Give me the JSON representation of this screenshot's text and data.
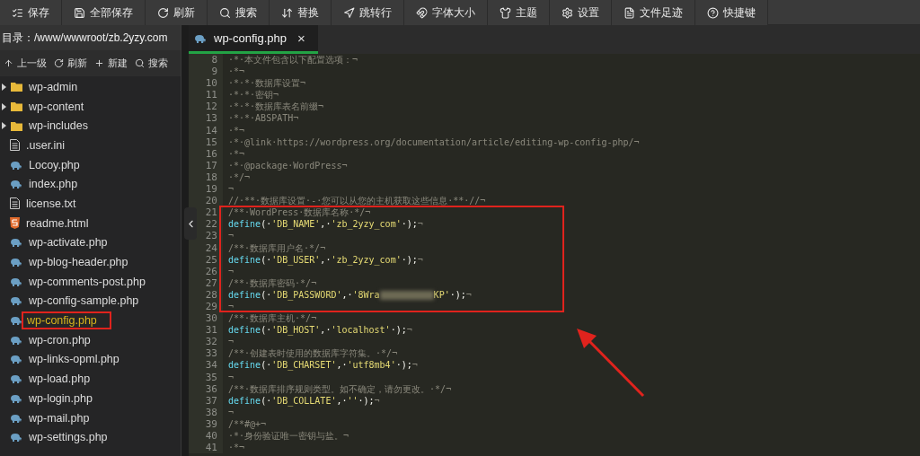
{
  "toolbar": [
    {
      "label": "保存"
    },
    {
      "label": "全部保存"
    },
    {
      "label": "刷新"
    },
    {
      "label": "搜索"
    },
    {
      "label": "替换"
    },
    {
      "label": "跳转行"
    },
    {
      "label": "字体大小"
    },
    {
      "label": "主题"
    },
    {
      "label": "设置"
    },
    {
      "label": "文件足迹"
    },
    {
      "label": "快捷键"
    }
  ],
  "sidebar": {
    "path": "目录：/www/wwwroot/zb.2yzy.com",
    "tools": [
      {
        "label": "上一级"
      },
      {
        "label": "刷新"
      },
      {
        "label": "新建"
      },
      {
        "label": "搜索"
      }
    ],
    "files": [
      {
        "name": "wp-admin",
        "kind": "folder",
        "selected": false
      },
      {
        "name": "wp-content",
        "kind": "folder",
        "selected": false
      },
      {
        "name": "wp-includes",
        "kind": "folder",
        "selected": false
      },
      {
        "name": ".user.ini",
        "kind": "text",
        "selected": false
      },
      {
        "name": "Locoy.php",
        "kind": "php",
        "selected": false
      },
      {
        "name": "index.php",
        "kind": "php",
        "selected": false
      },
      {
        "name": "license.txt",
        "kind": "text",
        "selected": false
      },
      {
        "name": "readme.html",
        "kind": "html",
        "selected": false
      },
      {
        "name": "wp-activate.php",
        "kind": "php",
        "selected": false
      },
      {
        "name": "wp-blog-header.php",
        "kind": "php",
        "selected": false
      },
      {
        "name": "wp-comments-post.php",
        "kind": "php",
        "selected": false
      },
      {
        "name": "wp-config-sample.php",
        "kind": "php",
        "selected": false
      },
      {
        "name": "wp-config.php",
        "kind": "php",
        "selected": true
      },
      {
        "name": "wp-cron.php",
        "kind": "php",
        "selected": false
      },
      {
        "name": "wp-links-opml.php",
        "kind": "php",
        "selected": false
      },
      {
        "name": "wp-load.php",
        "kind": "php",
        "selected": false
      },
      {
        "name": "wp-login.php",
        "kind": "php",
        "selected": false
      },
      {
        "name": "wp-mail.php",
        "kind": "php",
        "selected": false
      },
      {
        "name": "wp-settings.php",
        "kind": "php",
        "selected": false
      }
    ]
  },
  "tabs": [
    {
      "label": "wp-config.php",
      "close": "×",
      "selected": true
    }
  ],
  "editor": {
    "lines": [
      {
        "no": "8",
        "parts": [
          {
            "kind": "comment",
            "text": "·*·本文件包含以下配置选项：¬"
          }
        ]
      },
      {
        "no": "9",
        "parts": [
          {
            "kind": "comment",
            "text": "·*¬"
          }
        ]
      },
      {
        "no": "10",
        "parts": [
          {
            "kind": "comment",
            "text": "·*·*·数据库设置¬"
          }
        ]
      },
      {
        "no": "11",
        "parts": [
          {
            "kind": "comment",
            "text": "·*·*·密钥¬"
          }
        ]
      },
      {
        "no": "12",
        "parts": [
          {
            "kind": "comment",
            "text": "·*·*·数据库表名前缀¬"
          }
        ]
      },
      {
        "no": "13",
        "parts": [
          {
            "kind": "comment",
            "text": "·*·*·ABSPATH¬"
          }
        ]
      },
      {
        "no": "14",
        "parts": [
          {
            "kind": "comment",
            "text": "·*¬"
          }
        ]
      },
      {
        "no": "15",
        "parts": [
          {
            "kind": "comment",
            "text": "·*·@link·https://wordpress.org/documentation/article/editing-wp-config-php/¬"
          }
        ]
      },
      {
        "no": "16",
        "parts": [
          {
            "kind": "comment",
            "text": "·*¬"
          }
        ]
      },
      {
        "no": "17",
        "parts": [
          {
            "kind": "comment",
            "text": "·*·@package·WordPress¬"
          }
        ]
      },
      {
        "no": "18",
        "parts": [
          {
            "kind": "comment",
            "text": "·*/¬"
          }
        ]
      },
      {
        "no": "19",
        "parts": [
          {
            "kind": "comment",
            "text": "¬"
          }
        ]
      },
      {
        "no": "20",
        "parts": [
          {
            "kind": "comment",
            "text": "//·**·数据库设置·-·您可以从您的主机获取这些信息·**·//¬"
          }
        ]
      },
      {
        "no": "21",
        "parts": [
          {
            "kind": "comment",
            "text": "/**·WordPress·数据库名称·*/¬"
          }
        ]
      },
      {
        "no": "22",
        "parts": [
          {
            "kind": "fn",
            "text": "define"
          },
          {
            "kind": "punct",
            "text": "(·"
          },
          {
            "kind": "string",
            "text": "'DB_NAME'"
          },
          {
            "kind": "punct",
            "text": ",·"
          },
          {
            "kind": "string",
            "text": "'zb_2yzy_com'"
          },
          {
            "kind": "punct",
            "text": "·);"
          },
          {
            "kind": "comment",
            "text": "¬"
          }
        ]
      },
      {
        "no": "23",
        "parts": [
          {
            "kind": "comment",
            "text": "¬"
          }
        ]
      },
      {
        "no": "24",
        "parts": [
          {
            "kind": "comment",
            "text": "/**·数据库用户名·*/¬"
          }
        ]
      },
      {
        "no": "25",
        "parts": [
          {
            "kind": "fn",
            "text": "define"
          },
          {
            "kind": "punct",
            "text": "(·"
          },
          {
            "kind": "string",
            "text": "'DB_USER'"
          },
          {
            "kind": "punct",
            "text": ",·"
          },
          {
            "kind": "string",
            "text": "'zb_2yzy_com'"
          },
          {
            "kind": "punct",
            "text": "·);"
          },
          {
            "kind": "comment",
            "text": "¬"
          }
        ]
      },
      {
        "no": "26",
        "parts": [
          {
            "kind": "comment",
            "text": "¬"
          }
        ]
      },
      {
        "no": "27",
        "parts": [
          {
            "kind": "comment",
            "text": "/**·数据库密码·*/¬"
          }
        ]
      },
      {
        "no": "28",
        "parts": [
          {
            "kind": "fn",
            "text": "define"
          },
          {
            "kind": "punct",
            "text": "(·"
          },
          {
            "kind": "string",
            "text": "'DB_PASSWORD'"
          },
          {
            "kind": "punct",
            "text": ",·"
          },
          {
            "kind": "string",
            "text": "'8Wra"
          },
          {
            "kind": "redacted"
          },
          {
            "kind": "string",
            "text": "KP'"
          },
          {
            "kind": "punct",
            "text": "·);"
          },
          {
            "kind": "comment",
            "text": "¬"
          }
        ]
      },
      {
        "no": "29",
        "parts": [
          {
            "kind": "comment",
            "text": "¬"
          }
        ]
      },
      {
        "no": "30",
        "parts": [
          {
            "kind": "comment",
            "text": "/**·数据库主机·*/¬"
          }
        ]
      },
      {
        "no": "31",
        "parts": [
          {
            "kind": "fn",
            "text": "define"
          },
          {
            "kind": "punct",
            "text": "(·"
          },
          {
            "kind": "string",
            "text": "'DB_HOST'"
          },
          {
            "kind": "punct",
            "text": ",·"
          },
          {
            "kind": "string",
            "text": "'localhost'"
          },
          {
            "kind": "punct",
            "text": "·);"
          },
          {
            "kind": "comment",
            "text": "¬"
          }
        ]
      },
      {
        "no": "32",
        "parts": [
          {
            "kind": "comment",
            "text": "¬"
          }
        ]
      },
      {
        "no": "33",
        "parts": [
          {
            "kind": "comment",
            "text": "/**·创建表时使用的数据库字符集。·*/¬"
          }
        ]
      },
      {
        "no": "34",
        "parts": [
          {
            "kind": "fn",
            "text": "define"
          },
          {
            "kind": "punct",
            "text": "(·"
          },
          {
            "kind": "string",
            "text": "'DB_CHARSET'"
          },
          {
            "kind": "punct",
            "text": ",·"
          },
          {
            "kind": "string",
            "text": "'utf8mb4'"
          },
          {
            "kind": "punct",
            "text": "·);"
          },
          {
            "kind": "comment",
            "text": "¬"
          }
        ]
      },
      {
        "no": "35",
        "parts": [
          {
            "kind": "comment",
            "text": "¬"
          }
        ]
      },
      {
        "no": "36",
        "parts": [
          {
            "kind": "comment",
            "text": "/**·数据库排序规则类型。如不确定，请勿更改。·*/¬"
          }
        ]
      },
      {
        "no": "37",
        "parts": [
          {
            "kind": "fn",
            "text": "define"
          },
          {
            "kind": "punct",
            "text": "(·"
          },
          {
            "kind": "string",
            "text": "'DB_COLLATE'"
          },
          {
            "kind": "punct",
            "text": ",·"
          },
          {
            "kind": "string",
            "text": "''"
          },
          {
            "kind": "punct",
            "text": "·);"
          },
          {
            "kind": "comment",
            "text": "¬"
          }
        ]
      },
      {
        "no": "38",
        "parts": [
          {
            "kind": "comment",
            "text": "¬"
          }
        ]
      },
      {
        "no": "39",
        "parts": [
          {
            "kind": "comment",
            "text": "/**#@+¬"
          }
        ]
      },
      {
        "no": "40",
        "parts": [
          {
            "kind": "comment",
            "text": "·*·身份验证唯一密钥与盐。¬"
          }
        ]
      },
      {
        "no": "41",
        "parts": [
          {
            "kind": "comment",
            "text": "·*¬"
          }
        ]
      }
    ]
  }
}
